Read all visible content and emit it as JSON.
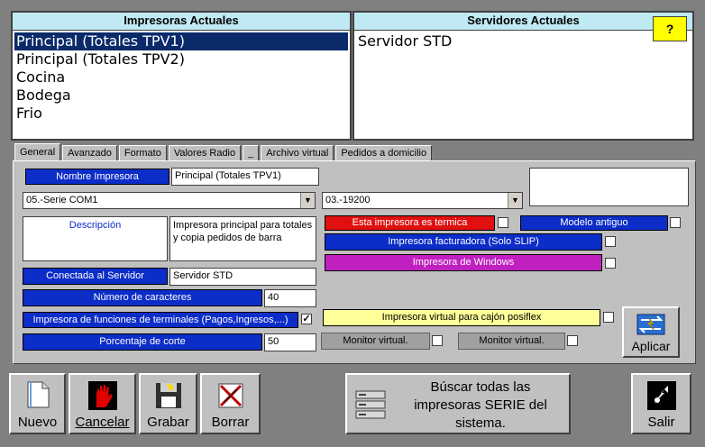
{
  "printers_panel": {
    "title": "Impresoras Actuales",
    "items": [
      "Principal (Totales TPV1)",
      "Principal (Totales TPV2)",
      "Cocina",
      "Bodega",
      "Frio"
    ]
  },
  "servers_panel": {
    "title": "Servidores Actuales",
    "items": [
      "Servidor STD"
    ],
    "help_label": "?"
  },
  "tabs": [
    "General",
    "Avanzado",
    "Formato",
    "Valores Radio",
    "_",
    "Archivo virtual",
    "Pedidos a domicilio"
  ],
  "form": {
    "printer_name_label": "Nombre Impresora",
    "printer_name_value": "Principal (Totales TPV1)",
    "port_value": "05.-Serie COM1",
    "baud_value": "03.-19200",
    "description_label": "Descripción",
    "description_value": "Impresora principal para totales y copia pedidos de barra",
    "thermal_label": "Esta impresora es termica",
    "old_model_label": "Modelo antiguo",
    "slip_label": "Impresora  facturadora (Solo SLIP)",
    "windows_label": "Impresora de Windows",
    "server_label": "Conectada al Servidor",
    "server_value": "Servidor STD",
    "chars_label": "Número de caracteres",
    "chars_value": "40",
    "terminal_funcs_label": "Impresora de funciones de terminales (Pagos,Ingresos,...)",
    "cut_pct_label": "Porcentaje de corte",
    "cut_pct_value": "50",
    "posiflex_label": "Impresora virtual para cajón posiflex",
    "monitor1_label": "Monitor virtual.",
    "monitor2_label": "Monitor virtual.",
    "apply_label": "Aplicar"
  },
  "toolbar": {
    "new_label": "Nuevo",
    "cancel_label": "Cancelar",
    "save_label": "Grabar",
    "delete_label": "Borrar",
    "search_serial_label": "Búscar todas las impresoras SERIE del sistema.",
    "exit_label": "Salir"
  },
  "colors": {
    "blue_label": "#0c2dc8",
    "red_label": "#e01010",
    "purple_label": "#c020c0",
    "yellow_label": "#ffff99",
    "header_cyan": "#bfeaf4",
    "selection": "#0a2a6a"
  }
}
